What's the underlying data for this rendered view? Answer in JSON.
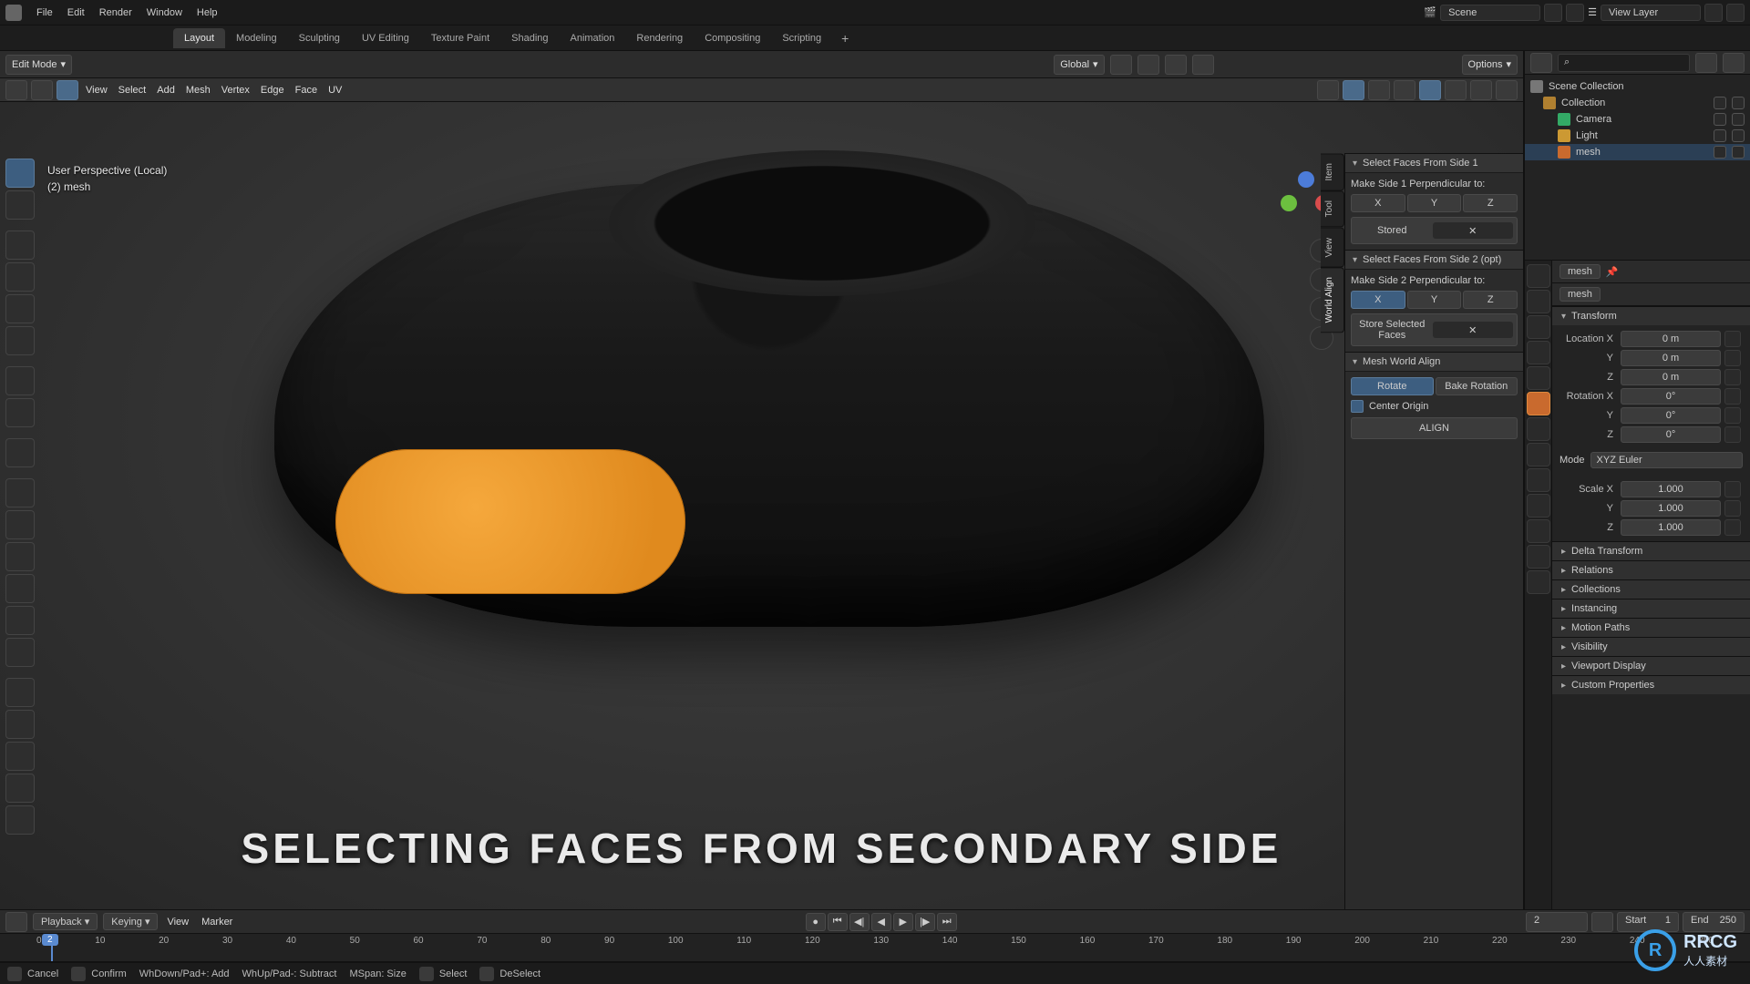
{
  "menubar": {
    "items": [
      "File",
      "Edit",
      "Render",
      "Window",
      "Help"
    ],
    "scene_label": "Scene",
    "viewlayer_label": "View Layer"
  },
  "workspace_tabs": {
    "items": [
      "Layout",
      "Modeling",
      "Sculpting",
      "UV Editing",
      "Texture Paint",
      "Shading",
      "Animation",
      "Rendering",
      "Compositing",
      "Scripting"
    ],
    "active_index": 0
  },
  "view3d_header": {
    "mode": "Edit Mode",
    "menus": [
      "View",
      "Select",
      "Add",
      "Mesh",
      "Vertex",
      "Edge",
      "Face",
      "UV"
    ],
    "orientation": "Global",
    "options_label": "Options"
  },
  "viewport_info": {
    "line1": "User Perspective (Local)",
    "line2": "(2) mesh"
  },
  "n_panel": {
    "tabs": [
      "Item",
      "Tool",
      "View",
      "World Align"
    ],
    "active_tab_index": 3,
    "s1": {
      "title": "Select Faces From Side 1",
      "label": "Make Side 1 Perpendicular to:",
      "axes": [
        "X",
        "Y",
        "Z"
      ],
      "stored_btn": "Stored"
    },
    "s2": {
      "title": "Select Faces From Side 2 (opt)",
      "label": "Make Side 2 Perpendicular to:",
      "axes": [
        "X",
        "Y",
        "Z"
      ],
      "active_axis_index": 0,
      "store_btn": "Store Selected Faces"
    },
    "s3": {
      "title": "Mesh World Align",
      "rotate": "Rotate",
      "bake": "Bake Rotation",
      "center": "Center Origin",
      "align": "ALIGN"
    }
  },
  "outliner": {
    "root": "Scene Collection",
    "collection": "Collection",
    "items": [
      {
        "name": "Camera",
        "type": "cam"
      },
      {
        "name": "Light",
        "type": "light"
      },
      {
        "name": "mesh",
        "type": "mesh",
        "selected": true
      }
    ]
  },
  "properties": {
    "crumb_obj": "mesh",
    "crumb_data": "mesh",
    "transform_title": "Transform",
    "location_label": "Location X",
    "rotation_label": "Rotation X",
    "scale_label": "Scale X",
    "axis_y": "Y",
    "axis_z": "Z",
    "loc": [
      "0 m",
      "0 m",
      "0 m"
    ],
    "rot": [
      "0°",
      "0°",
      "0°"
    ],
    "mode_label": "Mode",
    "mode_value": "XYZ Euler",
    "scale": [
      "1.000",
      "1.000",
      "1.000"
    ],
    "panels": [
      "Delta Transform",
      "Relations",
      "Collections",
      "Instancing",
      "Motion Paths",
      "Visibility",
      "Viewport Display",
      "Custom Properties"
    ]
  },
  "timeline": {
    "playback": "Playback",
    "keying": "Keying",
    "menus": [
      "View",
      "Marker"
    ],
    "current": 2,
    "start_label": "Start",
    "start": 1,
    "end_label": "End",
    "end": 250,
    "ticks": [
      "0",
      "10",
      "20",
      "30",
      "40",
      "50",
      "60",
      "70",
      "80",
      "90",
      "100",
      "110",
      "120",
      "130",
      "140",
      "150",
      "160",
      "170",
      "180",
      "190",
      "200",
      "210",
      "220",
      "230",
      "240",
      "250"
    ]
  },
  "statusbar": {
    "cancel": "Cancel",
    "confirm": "Confirm",
    "whdown": "WhDown/Pad+: Add",
    "whup": "WhUp/Pad-: Subtract",
    "mspan": "MSpan: Size",
    "select": "Select",
    "deselect": "DeSelect"
  },
  "caption": "SELECTING FACES FROM SECONDARY SIDE",
  "corner_logo": {
    "main": "RRCG",
    "sub": "人人素材"
  },
  "icons": {
    "triangle_down": "▾",
    "search": "⌕",
    "close": "✕",
    "play": "▶",
    "play_rev": "◀",
    "skip_start": "⏮",
    "skip_end": "⏭",
    "step_back": "◀|",
    "step_fwd": "|▶",
    "record": "●",
    "scene": "🎬",
    "layer": "☰"
  }
}
